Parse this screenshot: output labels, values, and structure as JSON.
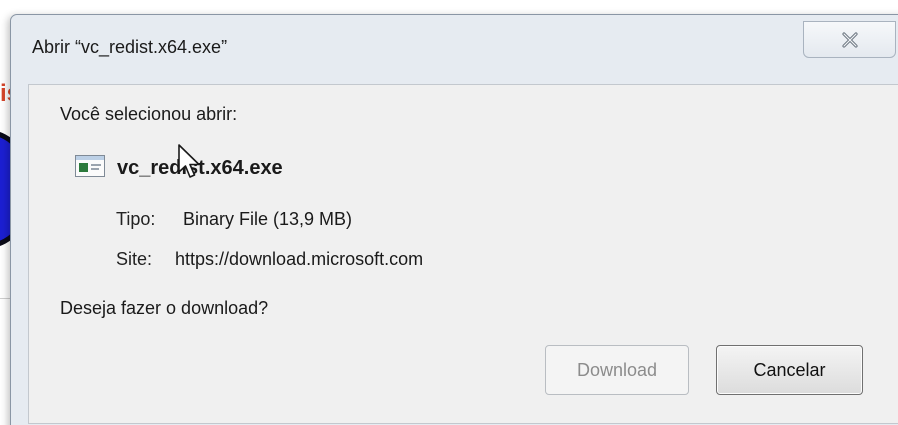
{
  "background": {
    "fragment_text": "is"
  },
  "dialog": {
    "title": "Abrir “vc_redist.x64.exe”",
    "close_icon": "close-x-icon",
    "selected_label": "Você selecionou abrir:",
    "file": {
      "icon": "executable-file-icon",
      "name": "vc_redist.x64.exe"
    },
    "type_label": "Tipo:",
    "type_value": "Binary File (13,9 MB)",
    "site_label": "Site:",
    "site_value": "https://download.microsoft.com",
    "question": "Deseja fazer o download?",
    "buttons": {
      "download": "Download",
      "cancel": "Cancelar"
    }
  },
  "colors": {
    "dialog_bg": "#e6ebf1",
    "panel_bg": "#f0f0f0",
    "background_accent": "#d6452a",
    "circle": "#1c1fd2"
  }
}
